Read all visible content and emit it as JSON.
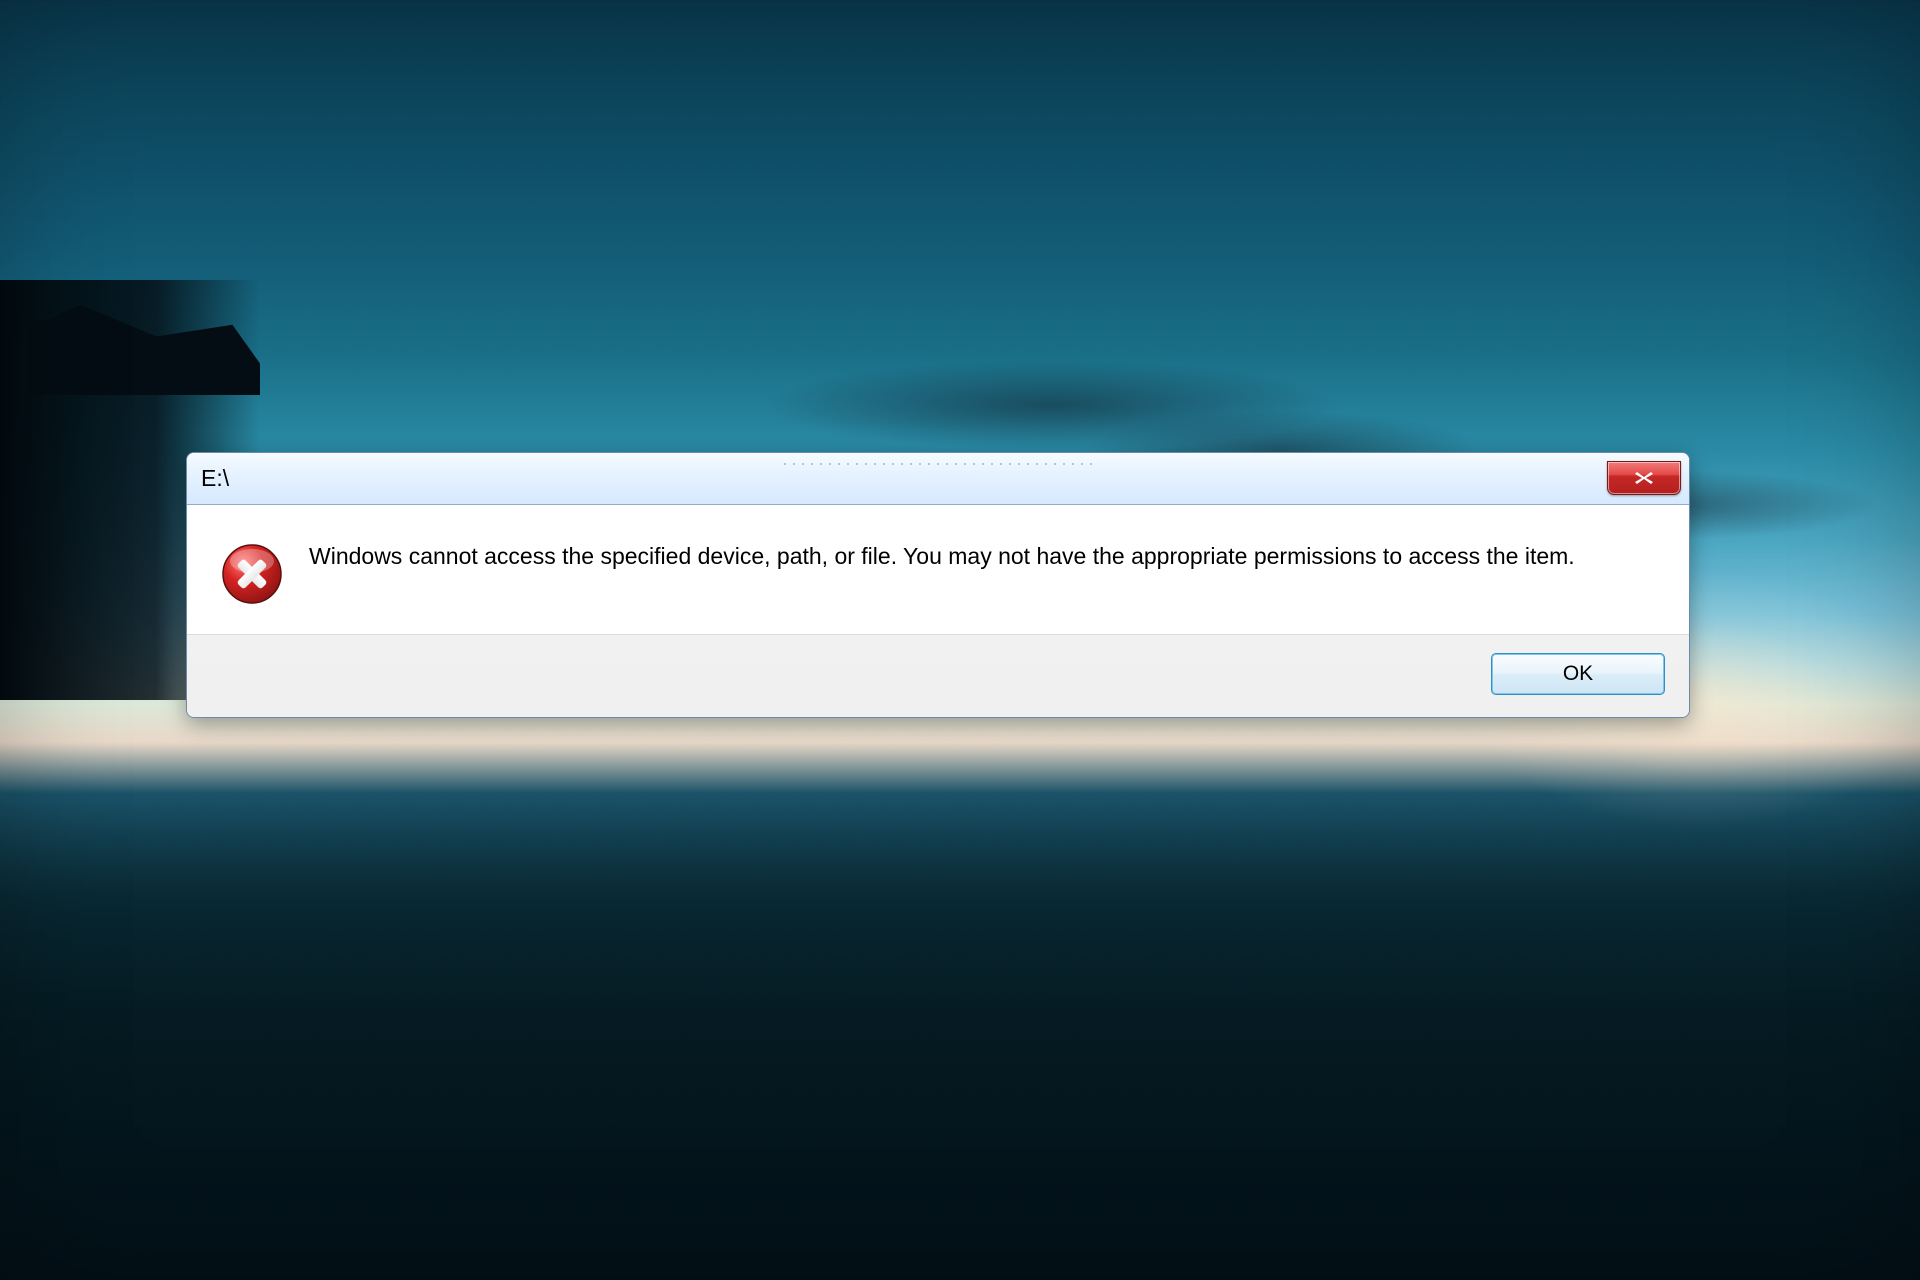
{
  "dialog": {
    "title": "E:\\",
    "message": "Windows cannot access the specified device, path, or file.  You may not have the appropriate permissions to access the item.",
    "ok_label": "OK",
    "icon": "error-icon",
    "close_icon": "close-icon"
  }
}
